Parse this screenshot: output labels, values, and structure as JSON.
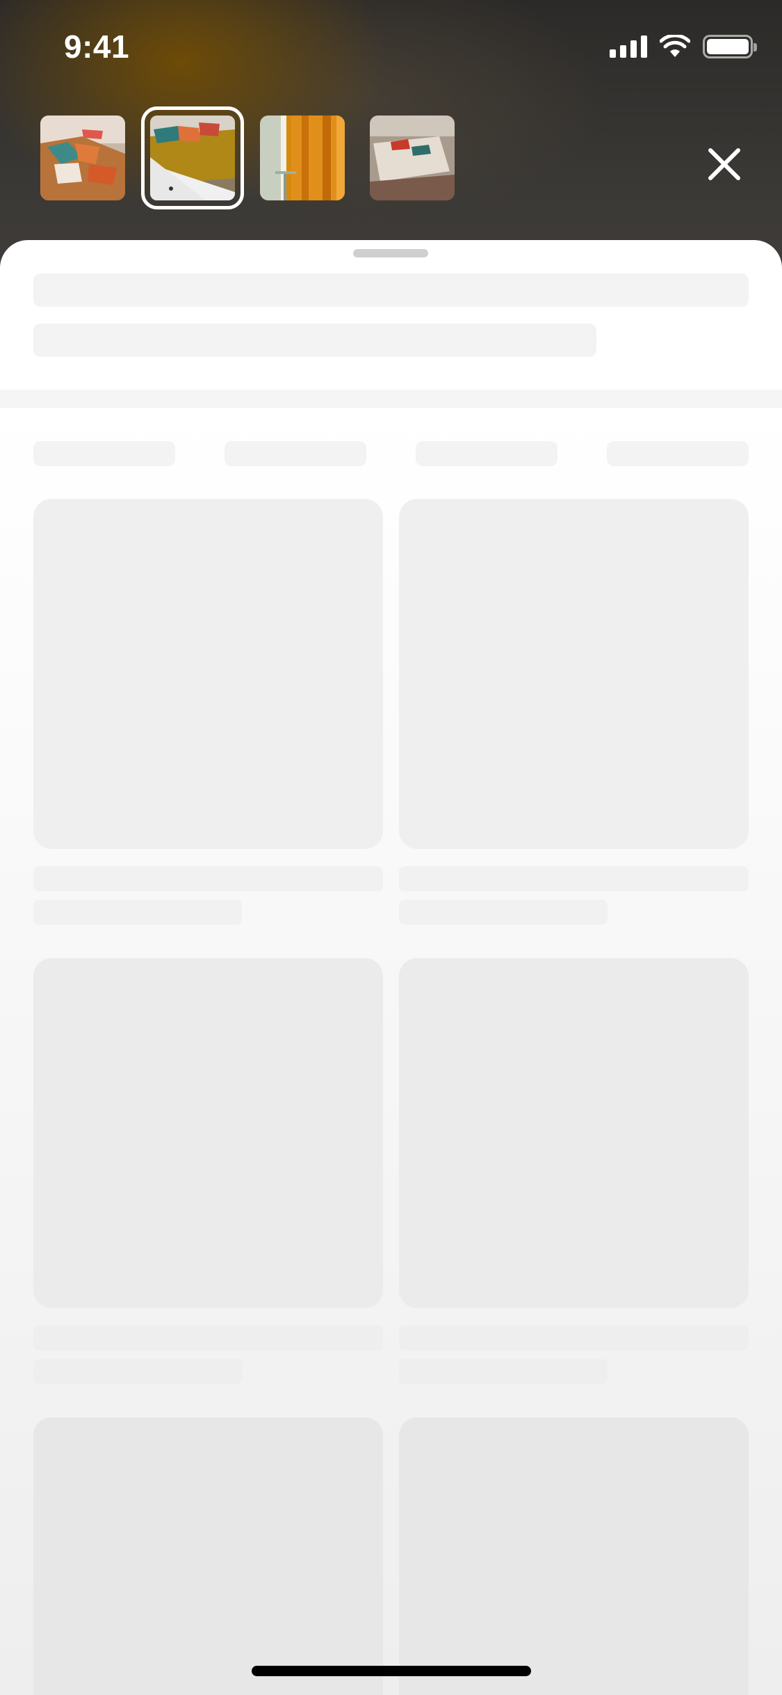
{
  "status_bar": {
    "time": "9:41",
    "icons": [
      "signal-icon",
      "wifi-icon",
      "battery-icon"
    ]
  },
  "thumbnails": [
    {
      "name": "bedroom-photo-1",
      "selected": false
    },
    {
      "name": "bedroom-photo-2",
      "selected": true
    },
    {
      "name": "curtain-photo",
      "selected": false
    },
    {
      "name": "pillow-photo",
      "selected": false
    }
  ],
  "close_icon": "close-icon",
  "colors": {
    "accent_bg": "#2c2a28",
    "skeleton": "#f0f0f0"
  }
}
